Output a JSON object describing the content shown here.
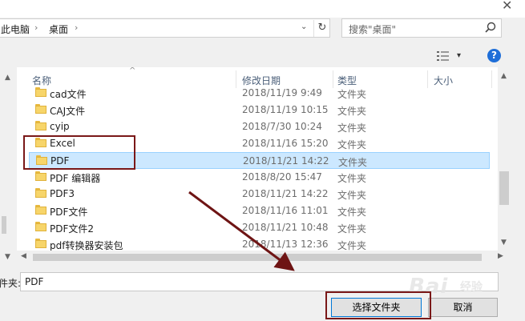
{
  "window": {
    "close_glyph": "✕"
  },
  "address_bar": {
    "crumbs": [
      "此电脑",
      "桌面"
    ],
    "separator": "›",
    "dropdown_glyph": "⌄",
    "refresh_glyph": "↻"
  },
  "search": {
    "placeholder": "搜索\"桌面\"",
    "icon": "search-icon"
  },
  "toolbar": {
    "view_icon": "view-options-icon",
    "view_drop": "▾",
    "help": "?"
  },
  "columns": {
    "name": "名称",
    "modified": "修改日期",
    "type": "类型",
    "size": "大小",
    "sort_caret": "^"
  },
  "rows": [
    {
      "name": "cad文件",
      "date": "2018/11/19 9:49",
      "type": "文件夹"
    },
    {
      "name": "CAJ文件",
      "date": "2018/11/19 10:15",
      "type": "文件夹"
    },
    {
      "name": "cyip",
      "date": "2018/7/30 10:24",
      "type": "文件夹"
    },
    {
      "name": "Excel",
      "date": "2018/11/16 15:20",
      "type": "文件夹"
    },
    {
      "name": "PDF",
      "date": "2018/11/21 14:22",
      "type": "文件夹",
      "selected": true
    },
    {
      "name": "PDF 编辑器",
      "date": "2018/8/20 15:47",
      "type": "文件夹"
    },
    {
      "name": "PDF3",
      "date": "2018/11/21 14:22",
      "type": "文件夹"
    },
    {
      "name": "PDF文件",
      "date": "2018/11/16 11:01",
      "type": "文件夹"
    },
    {
      "name": "PDF文件2",
      "date": "2018/11/21 10:48",
      "type": "文件夹"
    },
    {
      "name": "pdf转换器安装包",
      "date": "2018/11/13 12:36",
      "type": "文件夹"
    }
  ],
  "footer": {
    "folder_label": "件夹:",
    "folder_value": "PDF",
    "select_button": "选择文件夹",
    "cancel_button": "取消"
  },
  "watermark": {
    "text": "Bai",
    "sub": "经验"
  },
  "colors": {
    "selection": "#cce8ff",
    "annotation": "#7a1818",
    "accent": "#0078d7"
  }
}
